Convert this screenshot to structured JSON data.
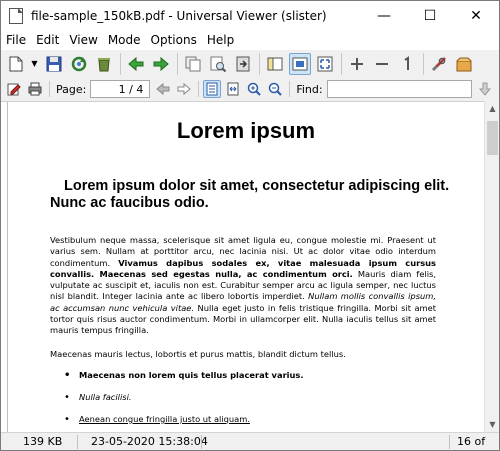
{
  "window": {
    "title": "file-sample_150kB.pdf - Universal Viewer (slister)",
    "minimize": "—",
    "maximize": "☐",
    "close": "✕"
  },
  "menu": [
    "File",
    "Edit",
    "View",
    "Mode",
    "Options",
    "Help"
  ],
  "toolbar": {
    "icons": [
      "open-icon",
      "save-icon",
      "reload-icon",
      "recycle-icon",
      "back-icon",
      "forward-icon",
      "copy-icon",
      "print-preview-icon",
      "exit-icon",
      "panel-icon",
      "fit-window-icon",
      "fullscreen-icon",
      "zoom-in-icon",
      "zoom-out-icon",
      "original-size-icon",
      "settings-icon",
      "plugin-icon"
    ]
  },
  "toolbar2": {
    "page_label": "Page:",
    "page_value": "1 / 4",
    "find_label": "Find:",
    "find_value": ""
  },
  "document": {
    "title": "Lorem ipsum",
    "heading": "Lorem ipsum dolor sit amet, consectetur adipiscing elit. Nunc ac faucibus odio.",
    "p1_a": "Vestibulum neque massa, scelerisque sit amet ligula eu, congue molestie mi. Praesent ut varius sem. Nullam at porttitor arcu, nec lacinia nisi. Ut ac dolor vitae odio interdum condimentum. ",
    "p1_b": "Vivamus dapibus sodales ex, vitae malesuada ipsum cursus convallis. Maecenas sed egestas nulla, ac condimentum orci.",
    "p1_c": " Mauris diam felis, vulputate ac suscipit et, iaculis non est. Curabitur semper arcu ac ligula semper, nec luctus nisl blandit. Integer lacinia ante ac libero lobortis imperdiet. ",
    "p1_d": "Nullam mollis convallis ipsum, ac accumsan nunc vehicula vitae.",
    "p1_e": " Nulla eget justo in felis tristique fringilla. Morbi sit amet tortor quis risus auctor condimentum. Morbi in ullamcorper elit. Nulla iaculis tellus sit amet mauris tempus fringilla.",
    "p2": "Maecenas mauris lectus, lobortis et purus mattis, blandit dictum tellus.",
    "list": [
      "Maecenas non lorem quis tellus placerat varius.",
      "Nulla facilisi.",
      "Aenean congue fringilla justo ut aliquam."
    ]
  },
  "status": {
    "size": "139 KB",
    "datetime": "23-05-2020 15:38:04",
    "pages": "16 of"
  }
}
